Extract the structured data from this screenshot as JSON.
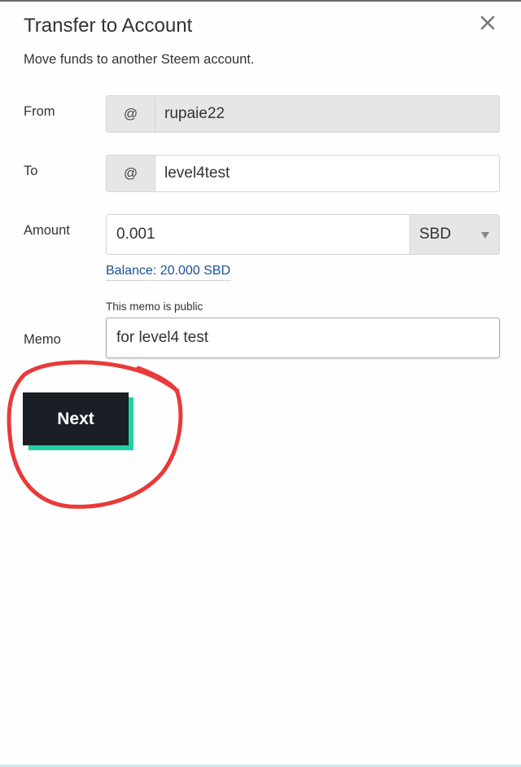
{
  "dialog": {
    "title": "Transfer to Account",
    "subtitle": "Move funds to another Steem account.",
    "close_icon": "close-icon"
  },
  "form": {
    "from": {
      "label": "From",
      "addon": "@",
      "value": "rupaie22",
      "disabled": true
    },
    "to": {
      "label": "To",
      "addon": "@",
      "value": "level4test"
    },
    "amount": {
      "label": "Amount",
      "value": "0.001",
      "currency": "SBD",
      "currency_icon": "chevron-down-icon",
      "balance": "Balance: 20.000 SBD"
    },
    "memo": {
      "label": "Memo",
      "note": "This memo is public",
      "value": "for level4 test"
    }
  },
  "actions": {
    "next_label": "Next"
  },
  "annotation": {
    "shape": "hand-drawn circle around Next button",
    "color": "#e83a3a"
  },
  "colors": {
    "button_bg": "#1a1f26",
    "button_shadow": "#1fd1a5",
    "balance_link": "#1a5099",
    "addon_bg": "#e6e6e6"
  }
}
